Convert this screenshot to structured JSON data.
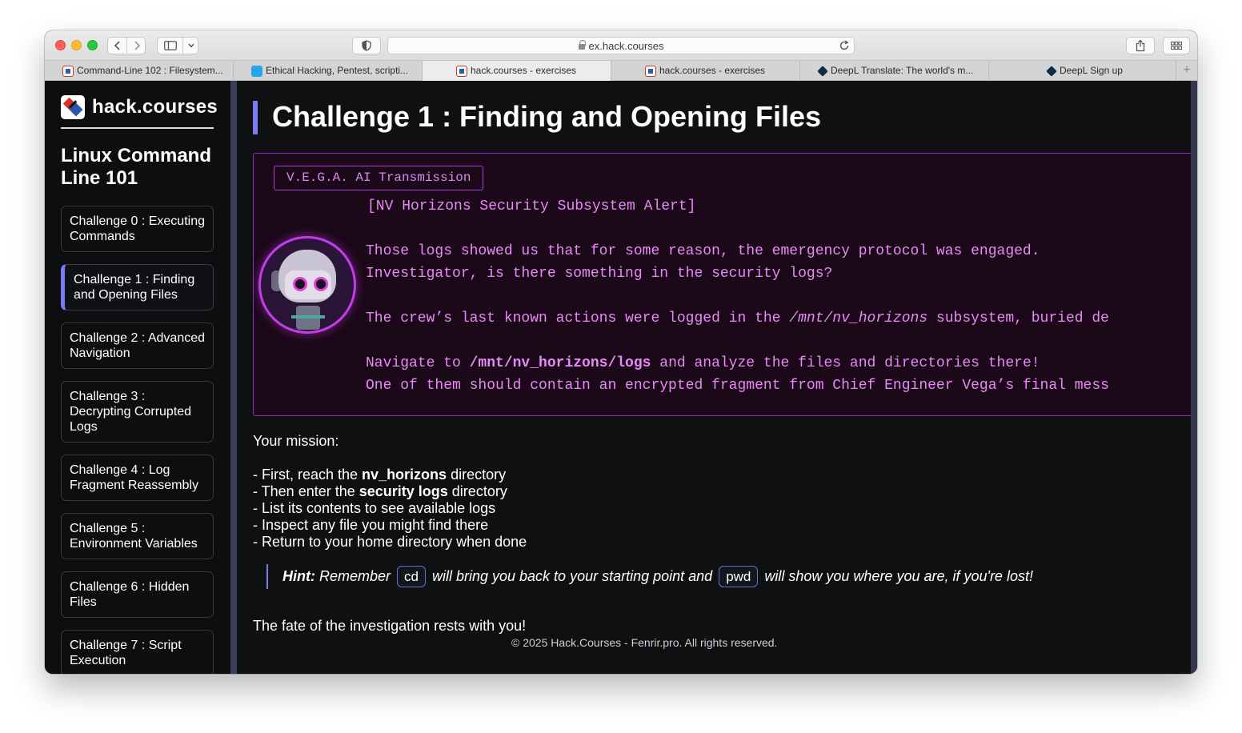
{
  "browser": {
    "url": "ex.hack.courses",
    "tabs": [
      {
        "label": "Command-Line 102 : Filesystem...",
        "icon": "hack-courses-favicon"
      },
      {
        "label": "Ethical Hacking, Pentest, scripti...",
        "icon": "blue-square-favicon"
      },
      {
        "label": "hack.courses - exercises",
        "icon": "hack-courses-favicon",
        "active": true
      },
      {
        "label": "hack.courses - exercises",
        "icon": "hack-courses-favicon"
      },
      {
        "label": "DeepL Translate: The world's m...",
        "icon": "deepl-favicon"
      },
      {
        "label": "DeepL Sign up",
        "icon": "deepl-favicon"
      }
    ],
    "new_tab_label": "+"
  },
  "sidebar": {
    "logo_text": "hack.courses",
    "course_title": "Linux Command Line 101",
    "items": [
      {
        "label": "Challenge 0 : Executing Commands"
      },
      {
        "label": "Challenge 1 : Finding and Opening Files",
        "active": true
      },
      {
        "label": "Challenge 2 : Advanced Navigation"
      },
      {
        "label": "Challenge 3 : Decrypting Corrupted Logs"
      },
      {
        "label": "Challenge 4 : Log Fragment Reassembly"
      },
      {
        "label": "Challenge 5 : Environment Variables"
      },
      {
        "label": "Challenge 6 : Hidden Files"
      },
      {
        "label": "Challenge 7 : Script Execution"
      }
    ]
  },
  "main": {
    "title": "Challenge 1 : Finding and Opening Files",
    "transmission": {
      "label": "V.E.G.A. AI Transmission",
      "alert": "[NV Horizons Security Subsystem Alert]",
      "line1": "Those logs showed us that for some reason, the emergency protocol was engaged.",
      "line2": "Investigator, is there something in the security logs?",
      "line3_pre": "The crew’s last known actions were logged in the ",
      "line3_path": "/mnt/nv_horizons",
      "line3_post": " subsystem, buried de",
      "line4_pre": "Navigate to ",
      "line4_path": "/mnt/nv_horizons/logs",
      "line4_post": " and analyze the files and directories there!",
      "line5": "One of them should contain an encrypted fragment from Chief Engineer Vega’s final mess"
    },
    "mission": {
      "title": "Your mission:",
      "step1_pre": "- First, reach the ",
      "step1_bold": "nv_horizons",
      "step1_post": " directory",
      "step2_pre": "- Then enter the ",
      "step2_bold": "security logs",
      "step2_post": " directory",
      "step3": "- List its contents to see available logs",
      "step4": "- Inspect any file you might find there",
      "step5": "- Return to your home directory when done"
    },
    "hint": {
      "label": "Hint:",
      "pre": " Remember ",
      "code1": "cd",
      "mid": " will bring you back to your starting point and ",
      "code2": "pwd",
      "post": " will show you where you are, if you're lost!"
    },
    "closing": "The fate of the investigation rests with you!",
    "footer": "© 2025 Hack.Courses - Fenrir.pro. All rights reserved."
  },
  "colors": {
    "accent": "#7c7cf0",
    "transmission_text": "#e78af5",
    "transmission_border": "#8b2db5",
    "page_bg": "#0f1012"
  }
}
